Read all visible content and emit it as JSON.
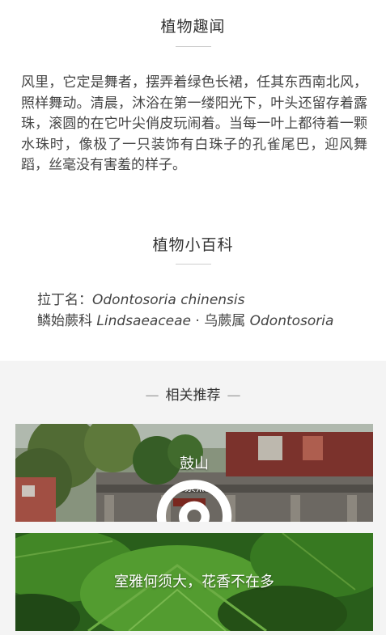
{
  "section_fun": {
    "title": "植物趣闻"
  },
  "story": {
    "text": "风里，它定是舞者，摆弄着绿色长裙，任其东西南北风，照样舞动。清晨，沐浴在第一缕阳光下，叶头还留存着露珠，滚圆的在它叶尖俏皮玩闹着。当每一叶上都待着一颗水珠时，像极了一只装饰有白珠子的孔雀尾巴，迎风舞蹈，丝毫没有害羞的样子。"
  },
  "section_wiki": {
    "title": "植物小百科"
  },
  "wiki": {
    "latin_label": "拉丁名：",
    "latin_name": "Odontosoria chinensis",
    "family_cn": "鳞始蕨科 ",
    "family_latin": "Lindsaeaceae",
    "sep": " · ",
    "genus_cn": "乌蕨属 ",
    "genus_latin": "Odontosoria"
  },
  "recommend": {
    "title": "相关推荐",
    "dash": "—",
    "cards": [
      {
        "name": "鼓山",
        "tag": "景点",
        "icon": "location-pin-icon"
      },
      {
        "name": "室雅何须大，花香不在多"
      }
    ]
  }
}
